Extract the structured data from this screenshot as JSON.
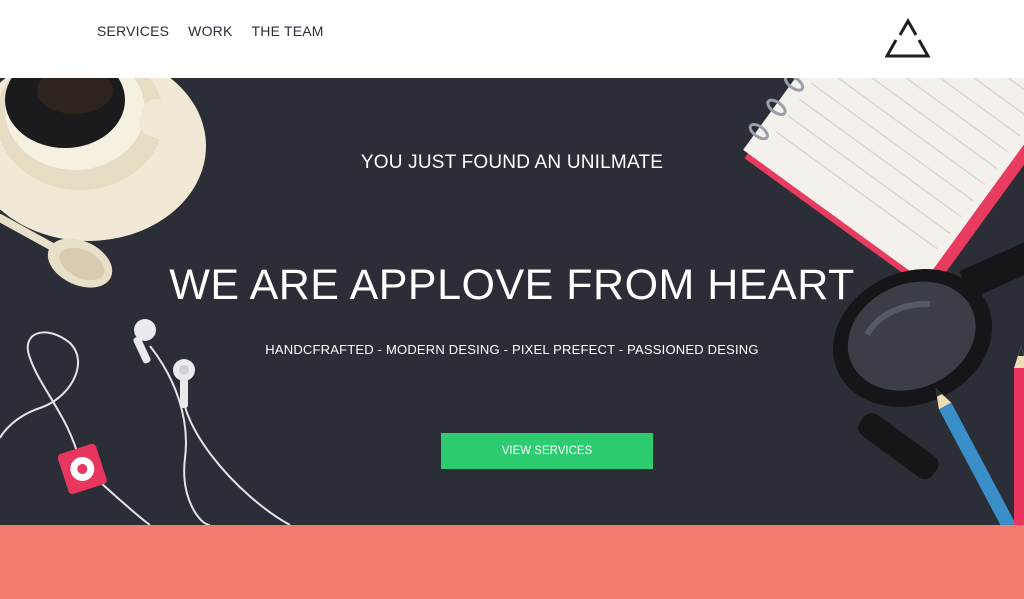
{
  "nav": {
    "items": [
      {
        "label": "SERVICES"
      },
      {
        "label": "WORK"
      },
      {
        "label": "THE TEAM"
      }
    ]
  },
  "hero": {
    "tagline": "YOU JUST FOUND AN UNILMATE",
    "headline": "WE ARE APPLOVE FROM HEART",
    "subline": "HANDCFRAFTED - MODERN DESING - PIXEL PREFECT - PASSIONED DESING",
    "cta_label": "VIEW SERVICES"
  },
  "colors": {
    "hero_bg": "#2b2e37",
    "accent_green": "#2ecc71",
    "band_coral": "#f07b6e",
    "nav_text": "#2b2d38"
  },
  "icons": [
    "triangle-logo-icon",
    "coffee-cup-icon",
    "spoon-icon",
    "earphones-icon",
    "music-player-icon",
    "notebook-icon",
    "glasses-icon",
    "pencil-icon"
  ]
}
